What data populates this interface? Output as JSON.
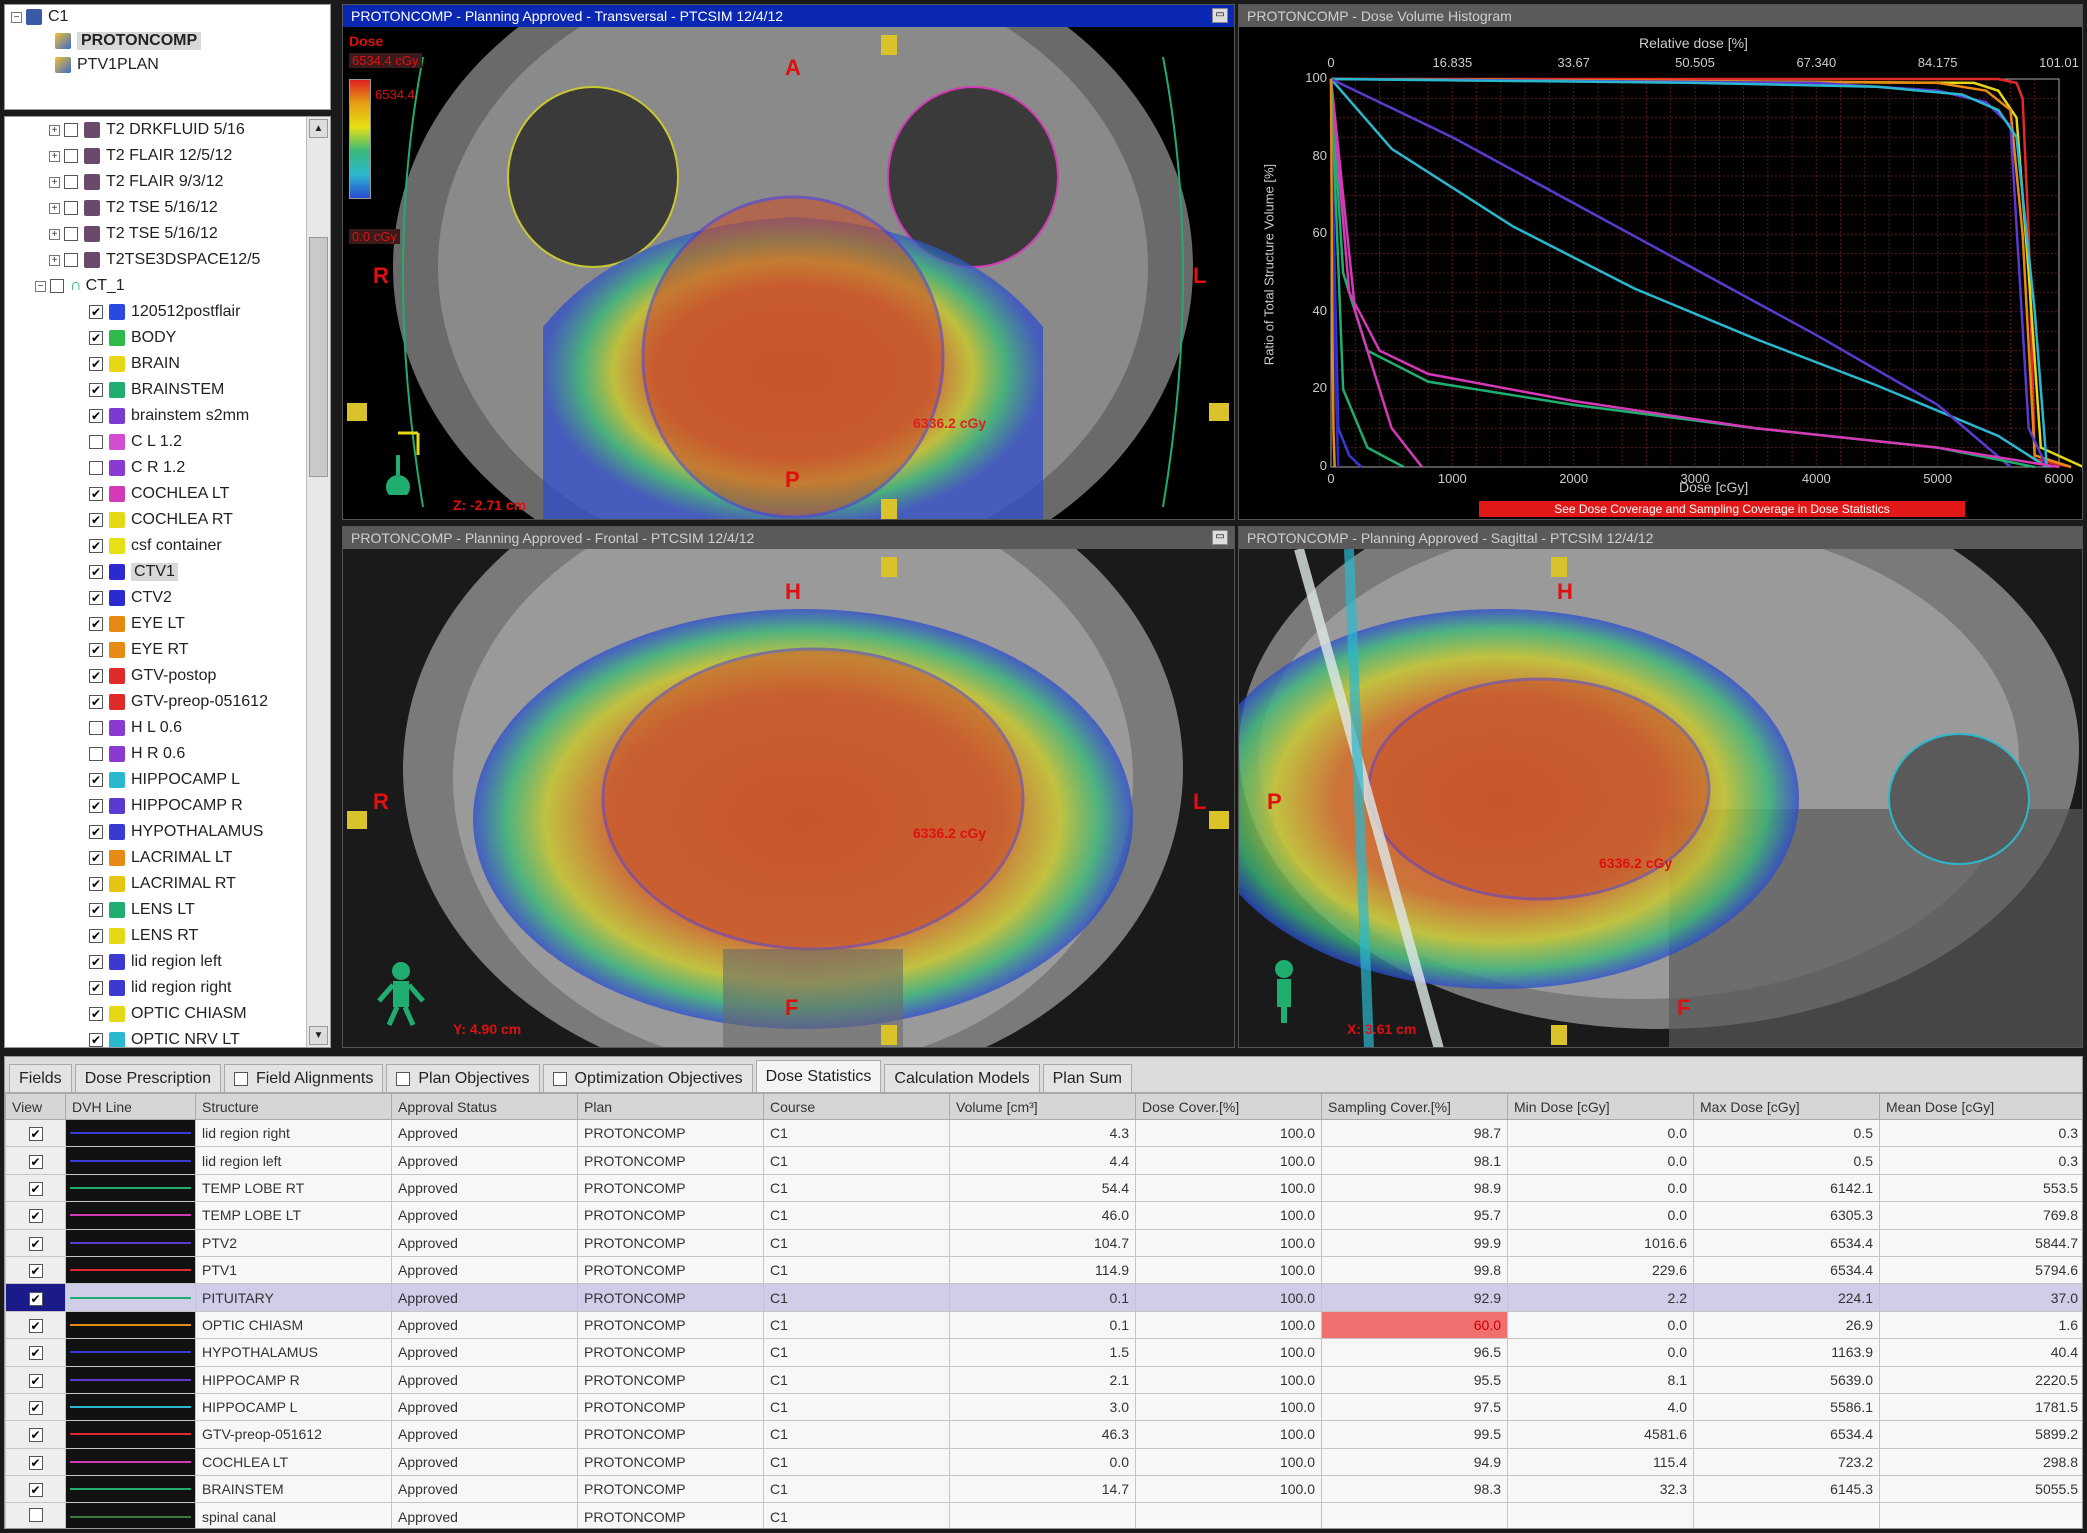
{
  "tree_top": {
    "root": "C1",
    "plan": "PROTONCOMP",
    "ptv_plan": "PTV1PLAN"
  },
  "tree": {
    "series": [
      "T2 DRKFLUID 5/16",
      "T2 FLAIR 12/5/12",
      "T2 FLAIR 9/3/12",
      "T2 TSE 5/16/12",
      "T2 TSE 5/16/12",
      "T2TSE3DSPACE12/5"
    ],
    "ct_label": "CT_1",
    "structures": [
      {
        "name": "120512postflair",
        "checked": true,
        "color": "#2a4adf"
      },
      {
        "name": "BODY",
        "checked": true,
        "color": "#2fb94a"
      },
      {
        "name": "BRAIN",
        "checked": true,
        "color": "#e6d814"
      },
      {
        "name": "BRAINSTEM",
        "checked": true,
        "color": "#1fae6f"
      },
      {
        "name": "brainstem s2mm",
        "checked": true,
        "color": "#7a3ad0"
      },
      {
        "name": "C L 1.2",
        "checked": false,
        "color": "#d44ccf"
      },
      {
        "name": "C R 1.2",
        "checked": false,
        "color": "#8a3ad0"
      },
      {
        "name": "COCHLEA LT",
        "checked": true,
        "color": "#d43ab8"
      },
      {
        "name": "COCHLEA RT",
        "checked": true,
        "color": "#e6d814"
      },
      {
        "name": "csf container",
        "checked": true,
        "color": "#e6e014"
      },
      {
        "name": "CTV1",
        "checked": true,
        "color": "#2a2acf",
        "selected": true
      },
      {
        "name": "CTV2",
        "checked": true,
        "color": "#2a2acf"
      },
      {
        "name": "EYE LT",
        "checked": true,
        "color": "#e68a14"
      },
      {
        "name": "EYE RT",
        "checked": true,
        "color": "#e68a14"
      },
      {
        "name": "GTV-postop",
        "checked": true,
        "color": "#e02a2a"
      },
      {
        "name": "GTV-preop-051612",
        "checked": true,
        "color": "#e02a2a"
      },
      {
        "name": "H L 0.6",
        "checked": false,
        "color": "#8a3ad0"
      },
      {
        "name": "H R 0.6",
        "checked": false,
        "color": "#8a3ad0"
      },
      {
        "name": "HIPPOCAMP L",
        "checked": true,
        "color": "#2ab8cf"
      },
      {
        "name": "HIPPOCAMP R",
        "checked": true,
        "color": "#5a3ad0"
      },
      {
        "name": "HYPOTHALAMUS",
        "checked": true,
        "color": "#3a3ad0"
      },
      {
        "name": "LACRIMAL LT",
        "checked": true,
        "color": "#e68a14"
      },
      {
        "name": "LACRIMAL RT",
        "checked": true,
        "color": "#e6c414"
      },
      {
        "name": "LENS LT",
        "checked": true,
        "color": "#1fae6f"
      },
      {
        "name": "LENS RT",
        "checked": true,
        "color": "#e6d814"
      },
      {
        "name": "lid region left",
        "checked": true,
        "color": "#3a3ad0"
      },
      {
        "name": "lid region right",
        "checked": true,
        "color": "#3a3ad0"
      },
      {
        "name": "OPTIC CHIASM",
        "checked": true,
        "color": "#e6d814"
      },
      {
        "name": "OPTIC NRV LT",
        "checked": true,
        "color": "#2ab8cf"
      }
    ]
  },
  "transversal": {
    "title": "PROTONCOMP - Planning Approved - Transversal - PTCSIM 12/4/12",
    "dose_label": "Dose",
    "dose_top": "6534.4",
    "dose_max": "6534.4",
    "dose_unit": "cGy",
    "dose_min_val": "0.0",
    "label_a": "A",
    "label_p": "P",
    "label_r": "R",
    "label_l": "L",
    "point_label": "6336.2 cGy",
    "coord": "Z: -2.71 cm"
  },
  "dvh": {
    "title": "PROTONCOMP - Dose Volume Histogram",
    "top_axis_label": "Relative dose [%]",
    "top_ticks": [
      "0",
      "16.835",
      "33.67",
      "50.505",
      "67.340",
      "84.175",
      "101.01"
    ],
    "bottom_axis_label": "Dose [cGy]",
    "bottom_ticks": [
      "0",
      "1000",
      "2000",
      "3000",
      "4000",
      "5000",
      "6000"
    ],
    "y_axis_label": "Ratio of Total Structure Volume [%]",
    "y_ticks": [
      "100",
      "80",
      "60",
      "40",
      "20",
      "0"
    ],
    "warning": "See Dose Coverage and Sampling Coverage in Dose Statistics"
  },
  "frontal": {
    "title": "PROTONCOMP - Planning Approved - Frontal - PTCSIM 12/4/12",
    "label_h": "H",
    "label_f": "F",
    "label_r": "R",
    "label_l": "L",
    "point_label": "6336.2 cGy",
    "coord": "Y: 4.90 cm"
  },
  "sagittal": {
    "title": "PROTONCOMP - Planning Approved - Sagittal - PTCSIM 12/4/12",
    "label_h": "H",
    "label_f": "F",
    "label_p": "P",
    "point_label": "6336.2 cGy",
    "coord": "X: 3.61 cm"
  },
  "tabs": [
    {
      "label": "Fields",
      "checkbox": false,
      "active": false
    },
    {
      "label": "Dose Prescription",
      "checkbox": false,
      "active": false
    },
    {
      "label": "Field Alignments",
      "checkbox": true,
      "active": false
    },
    {
      "label": "Plan Objectives",
      "checkbox": true,
      "active": false
    },
    {
      "label": "Optimization Objectives",
      "checkbox": true,
      "active": false
    },
    {
      "label": "Dose Statistics",
      "checkbox": false,
      "active": true
    },
    {
      "label": "Calculation Models",
      "checkbox": false,
      "active": false
    },
    {
      "label": "Plan Sum",
      "checkbox": false,
      "active": false
    }
  ],
  "table": {
    "columns": [
      "View",
      "DVH Line",
      "Structure",
      "Approval Status",
      "Plan",
      "Course",
      "Volume [cm³]",
      "Dose Cover.[%]",
      "Sampling Cover.[%]",
      "Min Dose [cGy]",
      "Max Dose [cGy]",
      "Mean Dose [cGy]"
    ],
    "rows": [
      {
        "checked": true,
        "line": "#3a3ad0",
        "structure": "lid region right",
        "status": "Approved",
        "plan": "PROTONCOMP",
        "course": "C1",
        "volume": "4.3",
        "dose_cover": "100.0",
        "sampling_cover": "98.7",
        "min": "0.0",
        "max": "0.5",
        "mean": "0.3"
      },
      {
        "checked": true,
        "line": "#3a3ad0",
        "structure": "lid region left",
        "status": "Approved",
        "plan": "PROTONCOMP",
        "course": "C1",
        "volume": "4.4",
        "dose_cover": "100.0",
        "sampling_cover": "98.1",
        "min": "0.0",
        "max": "0.5",
        "mean": "0.3"
      },
      {
        "checked": true,
        "line": "#1fae6f",
        "structure": "TEMP LOBE RT",
        "status": "Approved",
        "plan": "PROTONCOMP",
        "course": "C1",
        "volume": "54.4",
        "dose_cover": "100.0",
        "sampling_cover": "98.9",
        "min": "0.0",
        "max": "6142.1",
        "mean": "553.5"
      },
      {
        "checked": true,
        "line": "#d43ab8",
        "structure": "TEMP LOBE LT",
        "status": "Approved",
        "plan": "PROTONCOMP",
        "course": "C1",
        "volume": "46.0",
        "dose_cover": "100.0",
        "sampling_cover": "95.7",
        "min": "0.0",
        "max": "6305.3",
        "mean": "769.8"
      },
      {
        "checked": true,
        "line": "#5a3ad0",
        "structure": "PTV2",
        "status": "Approved",
        "plan": "PROTONCOMP",
        "course": "C1",
        "volume": "104.7",
        "dose_cover": "100.0",
        "sampling_cover": "99.9",
        "min": "1016.6",
        "max": "6534.4",
        "mean": "5844.7"
      },
      {
        "checked": true,
        "line": "#e02a2a",
        "structure": "PTV1",
        "status": "Approved",
        "plan": "PROTONCOMP",
        "course": "C1",
        "volume": "114.9",
        "dose_cover": "100.0",
        "sampling_cover": "99.8",
        "min": "229.6",
        "max": "6534.4",
        "mean": "5794.6"
      },
      {
        "checked": true,
        "line": "#1fae6f",
        "structure": "PITUITARY",
        "status": "Approved",
        "plan": "PROTONCOMP",
        "course": "C1",
        "volume": "0.1",
        "dose_cover": "100.0",
        "sampling_cover": "92.9",
        "min": "2.2",
        "max": "224.1",
        "mean": "37.0",
        "selected": true
      },
      {
        "checked": true,
        "line": "#e68a14",
        "structure": "OPTIC CHIASM",
        "status": "Approved",
        "plan": "PROTONCOMP",
        "course": "C1",
        "volume": "0.1",
        "dose_cover": "100.0",
        "sampling_cover": "60.0",
        "min": "0.0",
        "max": "26.9",
        "mean": "1.6",
        "warn": true
      },
      {
        "checked": true,
        "line": "#3a3ad0",
        "structure": "HYPOTHALAMUS",
        "status": "Approved",
        "plan": "PROTONCOMP",
        "course": "C1",
        "volume": "1.5",
        "dose_cover": "100.0",
        "sampling_cover": "96.5",
        "min": "0.0",
        "max": "1163.9",
        "mean": "40.4"
      },
      {
        "checked": true,
        "line": "#5a3ad0",
        "structure": "HIPPOCAMP R",
        "status": "Approved",
        "plan": "PROTONCOMP",
        "course": "C1",
        "volume": "2.1",
        "dose_cover": "100.0",
        "sampling_cover": "95.5",
        "min": "8.1",
        "max": "5639.0",
        "mean": "2220.5"
      },
      {
        "checked": true,
        "line": "#2ab8cf",
        "structure": "HIPPOCAMP L",
        "status": "Approved",
        "plan": "PROTONCOMP",
        "course": "C1",
        "volume": "3.0",
        "dose_cover": "100.0",
        "sampling_cover": "97.5",
        "min": "4.0",
        "max": "5586.1",
        "mean": "1781.5"
      },
      {
        "checked": true,
        "line": "#e02a2a",
        "structure": "GTV-preop-051612",
        "status": "Approved",
        "plan": "PROTONCOMP",
        "course": "C1",
        "volume": "46.3",
        "dose_cover": "100.0",
        "sampling_cover": "99.5",
        "min": "4581.6",
        "max": "6534.4",
        "mean": "5899.2"
      },
      {
        "checked": true,
        "line": "#d43ab8",
        "structure": "COCHLEA LT",
        "status": "Approved",
        "plan": "PROTONCOMP",
        "course": "C1",
        "volume": "0.0",
        "dose_cover": "100.0",
        "sampling_cover": "94.9",
        "min": "115.4",
        "max": "723.2",
        "mean": "298.8"
      },
      {
        "checked": true,
        "line": "#1fae6f",
        "structure": "BRAINSTEM",
        "status": "Approved",
        "plan": "PROTONCOMP",
        "course": "C1",
        "volume": "14.7",
        "dose_cover": "100.0",
        "sampling_cover": "98.3",
        "min": "32.3",
        "max": "6145.3",
        "mean": "5055.5"
      },
      {
        "checked": false,
        "line": "#3a7a3a",
        "structure": "spinal canal",
        "status": "Approved",
        "plan": "PROTONCOMP",
        "course": "C1",
        "volume": "",
        "dose_cover": "",
        "sampling_cover": "",
        "min": "",
        "max": "",
        "mean": ""
      }
    ]
  },
  "chart_data": {
    "type": "line",
    "title": "",
    "xlabel": "Dose [cGy]",
    "ylabel": "Ratio of Total Structure Volume [%]",
    "xlim": [
      0,
      6000
    ],
    "ylim": [
      0,
      100
    ],
    "top_axis": {
      "label": "Relative dose [%]",
      "ticks": [
        0,
        16.835,
        33.67,
        50.505,
        67.34,
        84.175,
        101.01
      ]
    },
    "grid": true,
    "series": [
      {
        "color": "#e02a2a",
        "x": [
          0,
          5500,
          5650,
          5700,
          5750,
          5800,
          6100
        ],
        "y": [
          100,
          100,
          99,
          95,
          60,
          2,
          0
        ]
      },
      {
        "color": "#e6d814",
        "x": [
          0,
          5300,
          5500,
          5650,
          5750,
          5850,
          6200
        ],
        "y": [
          100,
          99,
          97,
          90,
          50,
          5,
          0
        ]
      },
      {
        "color": "#e68a14",
        "x": [
          0,
          5000,
          5400,
          5600,
          5700,
          5800,
          6100
        ],
        "y": [
          100,
          99,
          97,
          92,
          60,
          3,
          0
        ]
      },
      {
        "color": "#5a3ad0",
        "x": [
          0,
          4000,
          5000,
          5400,
          5600,
          5750,
          5900
        ],
        "y": [
          100,
          99,
          97,
          94,
          88,
          10,
          0
        ]
      },
      {
        "color": "#2ab8cf",
        "x": [
          0,
          3000,
          4500,
          5200,
          5500,
          5650,
          5800,
          5900
        ],
        "y": [
          100,
          99,
          98,
          96,
          92,
          85,
          40,
          0
        ]
      },
      {
        "color": "#2ab8cf",
        "x": [
          0,
          500,
          1500,
          2500,
          3500,
          4500,
          5500,
          5900
        ],
        "y": [
          100,
          82,
          62,
          46,
          33,
          21,
          8,
          0
        ]
      },
      {
        "color": "#5a3ad0",
        "x": [
          0,
          1000,
          2000,
          3000,
          4000,
          5000,
          5600
        ],
        "y": [
          100,
          85,
          68,
          51,
          34,
          16,
          0
        ]
      },
      {
        "color": "#1fae6f",
        "x": [
          0,
          100,
          300,
          800,
          2000,
          3500,
          5000,
          5800
        ],
        "y": [
          100,
          50,
          30,
          22,
          16,
          10,
          5,
          0
        ]
      },
      {
        "color": "#d43ab8",
        "x": [
          0,
          150,
          400,
          800,
          2000,
          3500,
          5000,
          6000
        ],
        "y": [
          100,
          45,
          30,
          24,
          17,
          10,
          5,
          0
        ]
      },
      {
        "color": "#d43ab8",
        "x": [
          0,
          200,
          500,
          700,
          750
        ],
        "y": [
          100,
          40,
          10,
          2,
          0
        ]
      },
      {
        "color": "#3a3ad0",
        "x": [
          0,
          30,
          60,
          150,
          250
        ],
        "y": [
          100,
          50,
          10,
          3,
          0
        ]
      },
      {
        "color": "#2a2acf",
        "x": [
          0,
          20,
          40,
          60
        ],
        "y": [
          100,
          60,
          20,
          0
        ]
      },
      {
        "color": "#1fae6f",
        "x": [
          0,
          100,
          300,
          600
        ],
        "y": [
          100,
          20,
          5,
          0
        ]
      },
      {
        "color": "#e68a14",
        "x": [
          0,
          10,
          20,
          30
        ],
        "y": [
          100,
          40,
          10,
          0
        ]
      }
    ]
  }
}
